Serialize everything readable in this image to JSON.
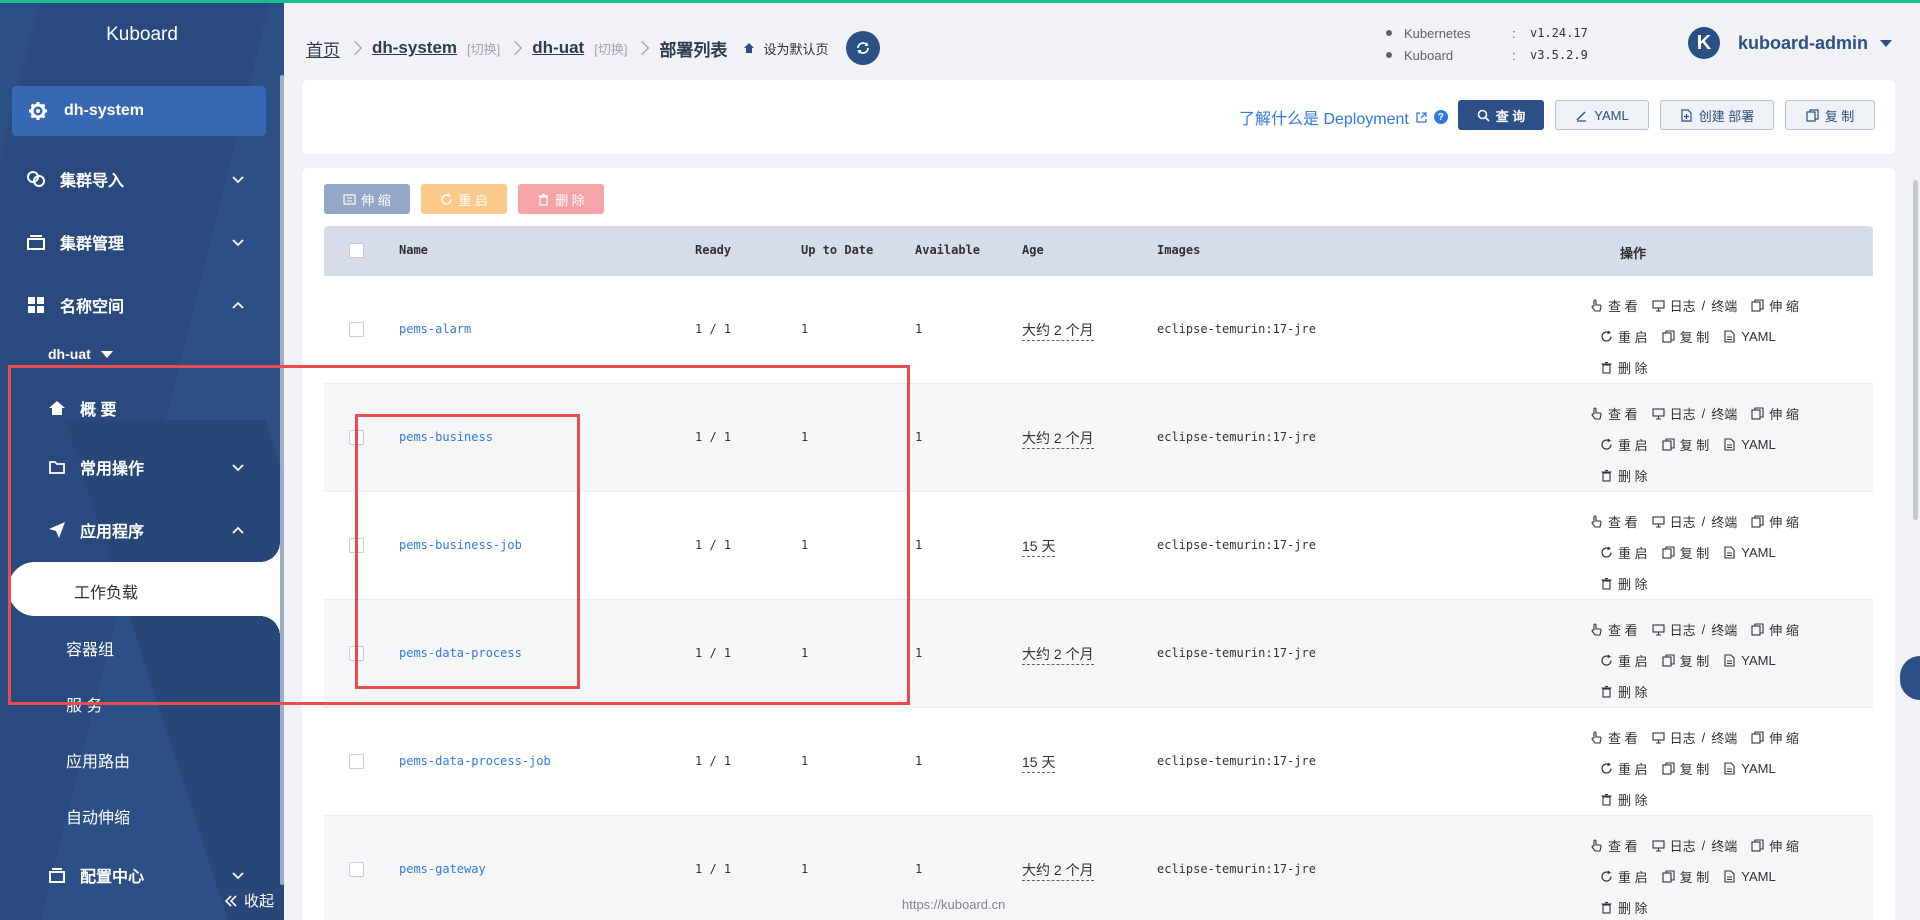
{
  "sidebar": {
    "logo": "Kuboard",
    "cluster": "dh-system",
    "menu": {
      "import": "集群导入",
      "manage": "集群管理",
      "namespace": "名称空间",
      "ns_selected": "dh-uat",
      "overview": "概 要",
      "common_ops": "常用操作",
      "apps": "应用程序",
      "workload": "工作负载",
      "pods": "容器组",
      "services": "服 务",
      "ingress": "应用路由",
      "autoscale": "自动伸缩",
      "config": "配置中心"
    },
    "collapse": "收起"
  },
  "header": {
    "breadcrumb": {
      "home": "首页",
      "cluster": "dh-system",
      "switch": "[切换]",
      "namespace": "dh-uat",
      "current": "部署列表",
      "set_default": "设为默认页"
    },
    "versions": [
      {
        "name": "Kubernetes",
        "sep": ":",
        "version": "v1.24.17"
      },
      {
        "name": "Kuboard",
        "sep": ":",
        "version": "v3.5.2.9"
      }
    ],
    "user": {
      "initial": "K",
      "name": "kuboard-admin"
    }
  },
  "toolbar": {
    "learn_link": "了解什么是 Deployment",
    "help": "?",
    "query": "查 询",
    "yaml": "YAML",
    "create": "创建 部署",
    "copy": "复 制"
  },
  "bulk_actions": {
    "scale": "伸 缩",
    "restart": "重 启",
    "delete": "删 除"
  },
  "table": {
    "columns": {
      "name": "Name",
      "ready": "Ready",
      "uptodate": "Up to Date",
      "available": "Available",
      "age": "Age",
      "images": "Images",
      "ops": "操作"
    },
    "ops_labels": {
      "view": "查 看",
      "logs": "日志",
      "slash": "/",
      "terminal": "终端",
      "scale": "伸 缩",
      "restart": "重 启",
      "copy": "复 制",
      "yaml": "YAML",
      "delete": "删 除"
    },
    "rows": [
      {
        "name": "pems-alarm",
        "ready": "1 / 1",
        "uptodate": "1",
        "available": "1",
        "age": "大约 2 个月",
        "image": "eclipse-temurin:17-jre"
      },
      {
        "name": "pems-business",
        "ready": "1 / 1",
        "uptodate": "1",
        "available": "1",
        "age": "大约 2 个月",
        "image": "eclipse-temurin:17-jre"
      },
      {
        "name": "pems-business-job",
        "ready": "1 / 1",
        "uptodate": "1",
        "available": "1",
        "age": "15 天",
        "image": "eclipse-temurin:17-jre"
      },
      {
        "name": "pems-data-process",
        "ready": "1 / 1",
        "uptodate": "1",
        "available": "1",
        "age": "大约 2 个月",
        "image": "eclipse-temurin:17-jre"
      },
      {
        "name": "pems-data-process-job",
        "ready": "1 / 1",
        "uptodate": "1",
        "available": "1",
        "age": "15 天",
        "image": "eclipse-temurin:17-jre"
      },
      {
        "name": "pems-gateway",
        "ready": "1 / 1",
        "uptodate": "1",
        "available": "1",
        "age": "大约 2 个月",
        "image": "eclipse-temurin:17-jre"
      }
    ]
  },
  "footer": {
    "url": "https://kuboard.cn"
  },
  "colors": {
    "primary": "#2c4f86",
    "link": "#2f7ae0",
    "accent_line": "#1bbf8f",
    "highlight_box": "#e84c4c"
  }
}
